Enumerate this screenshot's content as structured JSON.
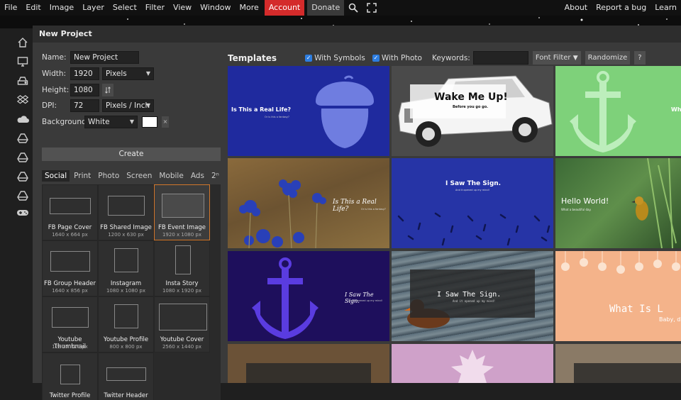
{
  "menu": {
    "items": [
      "File",
      "Edit",
      "Image",
      "Layer",
      "Select",
      "Filter",
      "View",
      "Window",
      "More"
    ],
    "account": "Account",
    "donate": "Donate",
    "right_items": [
      "About",
      "Report a bug",
      "Learn"
    ]
  },
  "dialog": {
    "title": "New Project",
    "name_label": "Name:",
    "name_value": "New Project",
    "width_label": "Width:",
    "width_value": "1920",
    "width_unit": "Pixels",
    "height_label": "Height:",
    "height_value": "1080",
    "dpi_label": "DPI:",
    "dpi_value": "72",
    "dpi_unit": "Pixels / Inch",
    "background_label": "Background:",
    "background_value": "White",
    "create_label": "Create"
  },
  "tabs": [
    "Social",
    "Print",
    "Photo",
    "Screen",
    "Mobile",
    "Ads",
    "2ⁿ"
  ],
  "presets": [
    {
      "name": "FB Page Cover",
      "size": "1640 x 664 px"
    },
    {
      "name": "FB Shared Image",
      "size": "1200 x 630 px"
    },
    {
      "name": "FB Event Image",
      "size": "1920 x 1080 px"
    },
    {
      "name": "FB Group Header",
      "size": "1640 x 856 px"
    },
    {
      "name": "Instagram",
      "size": "1080 x 1080 px"
    },
    {
      "name": "Insta Story",
      "size": "1080 x 1920 px"
    },
    {
      "name": "Youtube Thumbnail",
      "size": "1280 x 720 px"
    },
    {
      "name": "Youtube Profile",
      "size": "800 x 800 px"
    },
    {
      "name": "Youtube Cover",
      "size": "2560 x 1440 px"
    },
    {
      "name": "Twitter Profile",
      "size": ""
    },
    {
      "name": "Twitter Header",
      "size": ""
    }
  ],
  "templates_bar": {
    "title": "Templates",
    "with_symbols": "With Symbols",
    "with_photo": "With Photo",
    "keywords_label": "Keywords:",
    "font_filter": "Font Filter",
    "randomize": "Randomize",
    "help": "?"
  },
  "templates": {
    "t1_title": "Is This a Real Life?",
    "t1_sub": "Or is this a fantasy?",
    "t2_title": "Wake Me Up!",
    "t2_sub": "Before you go go.",
    "t3_title": "What",
    "t4_title": "Is This a Real Life?",
    "t4_sub": "Or is this a fantasy?",
    "t5_title": "I Saw The Sign.",
    "t5_sub": "And it opened up my mind!",
    "t6_title": "Hello World!",
    "t6_sub": "What a beautiful day.",
    "t7_title": "I Saw The Sign.",
    "t7_sub": "And it opened up my mind!",
    "t8_title": "I Saw The Sign.",
    "t8_sub": "And it opened up my mind!",
    "t9_title": "What Is L",
    "t9_sub": "Baby, d"
  },
  "colors": {
    "accent_red": "#d42b2b",
    "checkbox_blue": "#2d7de0",
    "selected_border": "#d2772b"
  }
}
